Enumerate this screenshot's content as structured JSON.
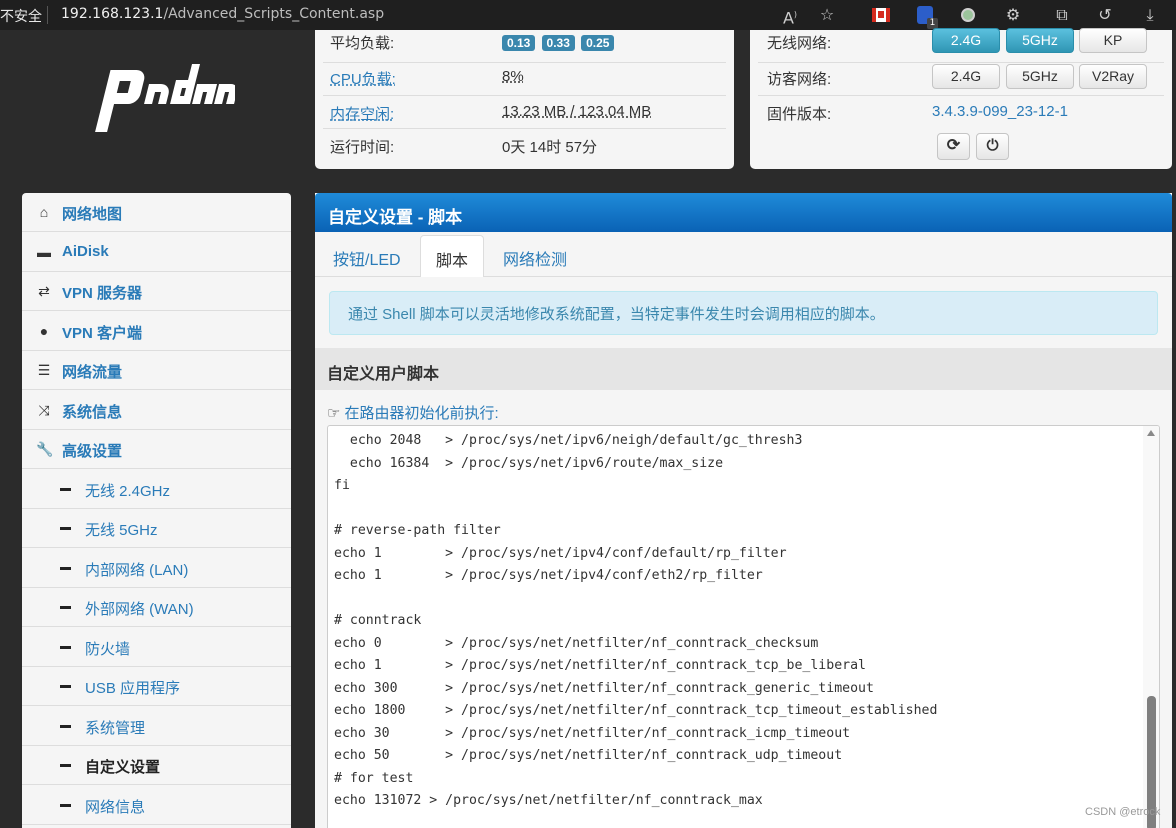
{
  "browser": {
    "insecure_label": "不安全",
    "url_host": "192.168.123.1",
    "url_path": "/Advanced_Scripts_Content.asp",
    "icons": [
      "read-aloud-icon",
      "favorite-star-icon",
      "canada-flag-icon",
      "bitwarden-icon",
      "extension-dot-icon",
      "extensions-icon",
      "collections-icon",
      "history-icon",
      "download-icon"
    ],
    "ext_badge": "1"
  },
  "logo": {
    "text": "padavan"
  },
  "status_left": {
    "rows": [
      {
        "label": "平均负载:",
        "loads": [
          "0.13",
          "0.33",
          "0.25"
        ]
      },
      {
        "label": "CPU负载:",
        "value": "8%"
      },
      {
        "label": "内存空闲:",
        "value": "13.23 MB / 123.04 MB"
      },
      {
        "label": "运行时间:",
        "value": "0天 14时 57分"
      }
    ]
  },
  "status_right": {
    "wireless_label": "无线网络:",
    "wireless_buttons": [
      "2.4G",
      "5GHz",
      "KP"
    ],
    "guest_label": "访客网络:",
    "guest_buttons": [
      "2.4G",
      "5GHz",
      "V2Ray"
    ],
    "firmware_label": "固件版本:",
    "firmware_value": "3.4.3.9-099_23-12-1",
    "action_icons": [
      "refresh-icon",
      "power-icon"
    ]
  },
  "sidebar": {
    "items": [
      {
        "label": "网络地图",
        "icon": "home-icon"
      },
      {
        "label": "AiDisk",
        "icon": "hdd-icon"
      },
      {
        "label": "VPN 服务器",
        "icon": "retweet-icon"
      },
      {
        "label": "VPN 客户端",
        "icon": "globe-icon"
      },
      {
        "label": "网络流量",
        "icon": "tasks-icon"
      },
      {
        "label": "系统信息",
        "icon": "random-icon"
      },
      {
        "label": "高级设置",
        "icon": "wrench-icon"
      }
    ],
    "sub_items": [
      {
        "label": "无线 2.4GHz"
      },
      {
        "label": "无线 5GHz"
      },
      {
        "label": "内部网络 (LAN)"
      },
      {
        "label": "外部网络 (WAN)"
      },
      {
        "label": "防火墙"
      },
      {
        "label": "USB 应用程序"
      },
      {
        "label": "系统管理"
      },
      {
        "label": "自定义设置",
        "active": true
      },
      {
        "label": "网络信息"
      }
    ]
  },
  "main": {
    "title": "自定义设置 - 脚本",
    "tabs": [
      "按钮/LED",
      "脚本",
      "网络检测"
    ],
    "active_tab": "脚本",
    "alert": "通过 Shell 脚本可以灵活地修改系统配置，当特定事件发生时会调用相应的脚本。",
    "section_title": "自定义用户脚本",
    "script_label": "在路由器初始化前执行:",
    "script_lines": [
      "  echo 2048   > /proc/sys/net/ipv6/neigh/default/gc_thresh3",
      "  echo 16384  > /proc/sys/net/ipv6/route/max_size",
      "fi",
      "",
      "# reverse-path filter",
      "echo 1        > /proc/sys/net/ipv4/conf/default/rp_filter",
      "echo 1        > /proc/sys/net/ipv4/conf/eth2/rp_filter",
      "",
      "# conntrack",
      "echo 0        > /proc/sys/net/netfilter/nf_conntrack_checksum",
      "echo 1        > /proc/sys/net/netfilter/nf_conntrack_tcp_be_liberal",
      "echo 300      > /proc/sys/net/netfilter/nf_conntrack_generic_timeout",
      "echo 1800     > /proc/sys/net/netfilter/nf_conntrack_tcp_timeout_established",
      "echo 30       > /proc/sys/net/netfilter/nf_conntrack_icmp_timeout",
      "echo 50       > /proc/sys/net/netfilter/nf_conntrack_udp_timeout",
      "# for test",
      "echo 131072 > /proc/sys/net/netfilter/nf_conntrack_max"
    ]
  },
  "watermark": "CSDN @etrock",
  "colors": {
    "link": "#2a7bb8",
    "header_blue": "#0a62b5",
    "badge": "#3a87ad",
    "alert_bg": "#d9edf7",
    "dark_bg": "#2b2b2b"
  }
}
